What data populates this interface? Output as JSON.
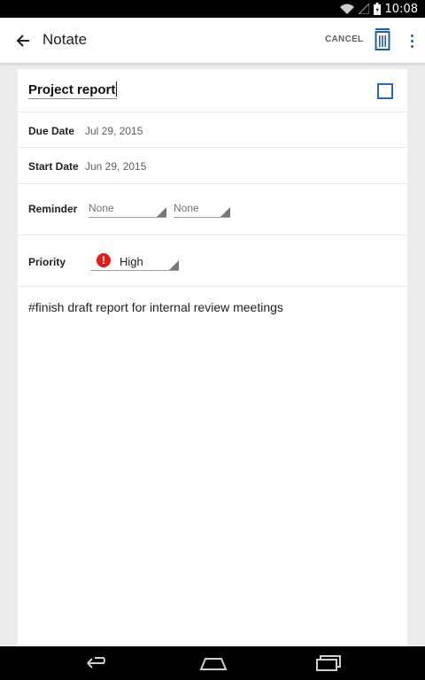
{
  "status_bar": {
    "time": "10:08"
  },
  "app_bar": {
    "title": "Notate",
    "cancel_label": "CANCEL"
  },
  "task": {
    "title": "Project report",
    "due_date_label": "Due Date",
    "due_date_value": "Jul 29, 2015",
    "start_date_label": "Start Date",
    "start_date_value": "Jun 29, 2015",
    "reminder_label": "Reminder",
    "reminder_first": "None",
    "reminder_second": "None",
    "priority_label": "Priority",
    "priority_icon": "!",
    "priority_value": "High",
    "note": "#finish draft report for internal review meetings"
  },
  "colors": {
    "accent": "#2c6ab4",
    "priority_high": "#e21b1b",
    "app_bar_bg": "#ffffff"
  },
  "icons": [
    "wifi-icon",
    "signal-icon",
    "battery-icon",
    "back-arrow-icon",
    "trash-icon",
    "overflow-menu-icon",
    "checkbox-icon",
    "priority-alert-icon",
    "nav-back-icon",
    "nav-home-icon",
    "nav-recents-icon"
  ]
}
